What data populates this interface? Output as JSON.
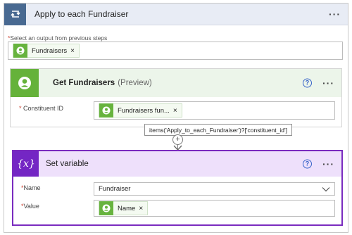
{
  "loop": {
    "title": "Apply to each Fundraiser",
    "more_label": "···",
    "select_label": "Select an output from previous steps",
    "required_mark": "*",
    "token": {
      "label": "Fundraisers",
      "remove": "×"
    }
  },
  "get_fundraisers": {
    "title": "Get Fundraisers",
    "preview": "(Preview)",
    "help": "?",
    "more_label": "···",
    "field_label": "Constituent ID",
    "token": {
      "label": "Fundraisers fun...",
      "remove": "×"
    }
  },
  "tooltip": {
    "expression": "items('Apply_to_each_Fundraiser')?['constituent_id']"
  },
  "connector": {
    "add_label": "+"
  },
  "set_variable": {
    "icon_text": "{x}",
    "title": "Set variable",
    "help": "?",
    "more_label": "···",
    "name_label": "Name",
    "name_value": "Fundraiser",
    "value_label": "Value",
    "value_token": {
      "label": "Name",
      "remove": "×"
    }
  },
  "colors": {
    "loop_accent": "#486991",
    "connector_accent": "#65b23a",
    "variable_accent": "#7426c4",
    "required": "#cc4433",
    "help": "#3763c9"
  },
  "icons": {
    "loop": "loop-arrows-icon",
    "connector": "person-badge-icon",
    "variable": "variable-braces-icon",
    "help": "question-circle-icon",
    "dropdown": "chevron-down-icon"
  }
}
